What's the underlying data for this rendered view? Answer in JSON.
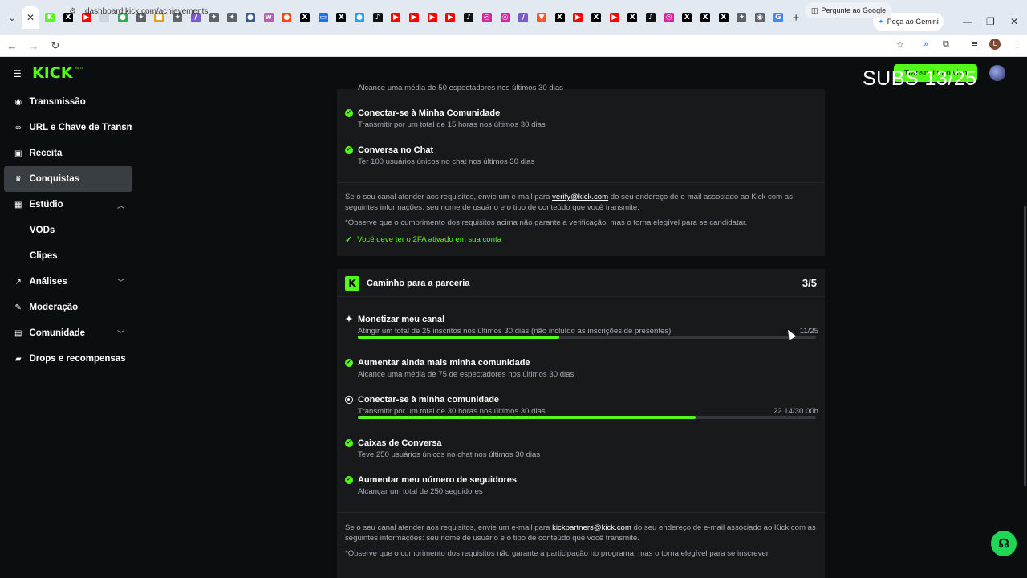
{
  "browser": {
    "url": "dashboard.kick.com/achievements",
    "gemini_label": "Peça ao Gemini",
    "google_pill": "Pergunte ao Google",
    "profile_initial": "L",
    "tabs": [
      {
        "icon": "kick-icon",
        "color": "#53fc18",
        "glyph": "K"
      },
      {
        "icon": "x-icon",
        "color": "#000000",
        "glyph": "X"
      },
      {
        "icon": "youtube-icon",
        "color": "#ff0000",
        "glyph": "▶"
      },
      {
        "icon": "blank-icon",
        "color": "#cfd6e0",
        "glyph": ""
      },
      {
        "icon": "globe-icon",
        "color": "#3aa757",
        "glyph": "●"
      },
      {
        "icon": "gear-icon",
        "color": "#5f6368",
        "glyph": "✦"
      },
      {
        "icon": "sheets-icon",
        "color": "#e2a01d",
        "glyph": "■"
      },
      {
        "icon": "gear-icon",
        "color": "#5f6368",
        "glyph": "✦"
      },
      {
        "icon": "feather-icon",
        "color": "#7a5cc8",
        "glyph": "/"
      },
      {
        "icon": "gear-icon",
        "color": "#5f6368",
        "glyph": "✦"
      },
      {
        "icon": "gear-icon",
        "color": "#5f6368",
        "glyph": "✦"
      },
      {
        "icon": "circle-icon",
        "color": "#3b5998",
        "glyph": "●"
      },
      {
        "icon": "feather-icon",
        "color": "#b85fae",
        "glyph": "w"
      },
      {
        "icon": "reddit-icon",
        "color": "#ff4500",
        "glyph": "●"
      },
      {
        "icon": "x-icon",
        "color": "#000000",
        "glyph": "X"
      },
      {
        "icon": "mail-icon",
        "color": "#1a73e8",
        "glyph": "▭"
      },
      {
        "icon": "x-icon",
        "color": "#000000",
        "glyph": "X"
      },
      {
        "icon": "circle-icon",
        "color": "#1da1f2",
        "glyph": "●"
      },
      {
        "icon": "tiktok-icon",
        "color": "#111111",
        "glyph": "♪"
      },
      {
        "icon": "youtube-icon",
        "color": "#ff0000",
        "glyph": "▶"
      },
      {
        "icon": "youtube-icon",
        "color": "#ff0000",
        "glyph": "▶"
      },
      {
        "icon": "youtube-icon",
        "color": "#ff0000",
        "glyph": "▶"
      },
      {
        "icon": "youtube-icon",
        "color": "#ff0000",
        "glyph": "▶"
      },
      {
        "icon": "tiktok-icon",
        "color": "#111111",
        "glyph": "♪"
      },
      {
        "icon": "instagram-icon",
        "color": "#d6249f",
        "glyph": "◎"
      },
      {
        "icon": "instagram-icon",
        "color": "#d6249f",
        "glyph": "◎"
      },
      {
        "icon": "feather-icon",
        "color": "#7a5cc8",
        "glyph": "/"
      },
      {
        "icon": "brave-icon",
        "color": "#fb542b",
        "glyph": "▼"
      },
      {
        "icon": "x-icon",
        "color": "#000000",
        "glyph": "X"
      },
      {
        "icon": "youtube-icon",
        "color": "#ff0000",
        "glyph": "▶"
      },
      {
        "icon": "x-icon",
        "color": "#000000",
        "glyph": "X"
      },
      {
        "icon": "youtube-icon",
        "color": "#ff0000",
        "glyph": "▶"
      },
      {
        "icon": "x-icon",
        "color": "#000000",
        "glyph": "X"
      },
      {
        "icon": "tiktok-icon",
        "color": "#111111",
        "glyph": "♪"
      },
      {
        "icon": "instagram-icon",
        "color": "#d6249f",
        "glyph": "◎"
      },
      {
        "icon": "x-icon",
        "color": "#000000",
        "glyph": "X"
      },
      {
        "icon": "x-icon",
        "color": "#000000",
        "glyph": "X"
      },
      {
        "icon": "x-icon",
        "color": "#000000",
        "glyph": "X"
      },
      {
        "icon": "gear-icon",
        "color": "#5f6368",
        "glyph": "✦"
      },
      {
        "icon": "chrome-icon",
        "color": "#5f6368",
        "glyph": "◉"
      },
      {
        "icon": "google-icon",
        "color": "#4285f4",
        "glyph": "G"
      }
    ]
  },
  "header": {
    "logo": "KICK",
    "beta": "BETA",
    "go_live": "Transmitir ao vivo",
    "overlay": "SUBS  13/25"
  },
  "sidebar": {
    "items": [
      {
        "label": "Transmissão",
        "icon": "broadcast-icon",
        "glyph": "◉"
      },
      {
        "label": "URL e Chave de Transmissão",
        "icon": "link-icon",
        "glyph": "∞"
      },
      {
        "label": "Receita",
        "icon": "revenue-icon",
        "glyph": "▣"
      },
      {
        "label": "Conquistas",
        "icon": "trophy-icon",
        "glyph": "♛"
      },
      {
        "label": "Estúdio",
        "icon": "studio-icon",
        "glyph": "▦"
      },
      {
        "label": "Análises",
        "icon": "analytics-icon",
        "glyph": "↗"
      },
      {
        "label": "Moderação",
        "icon": "wrench-icon",
        "glyph": "✎"
      },
      {
        "label": "Comunidade",
        "icon": "community-icon",
        "glyph": "▤"
      },
      {
        "label": "Drops e recompensas",
        "icon": "drops-icon",
        "glyph": "▰"
      }
    ],
    "sub_items": [
      "VODs",
      "Clipes"
    ]
  },
  "verification": {
    "cut_desc": "Alcance uma média de 50 espectadores nos últimos 30 dias",
    "requirements": [
      {
        "title": "Conectar-se à Minha Comunidade",
        "desc": "Transmitir por um total de 15 horas nos últimos 30 dias"
      },
      {
        "title": "Conversa no Chat",
        "desc": "Ter 100 usuários únicos no chat nos últimos 30 dias"
      }
    ],
    "note_before": "Se o seu canal atender aos requisitos, envie um e-mail para ",
    "email": "verify@kick.com",
    "note_after": " do seu endereço de e-mail associado ao Kick com as seguintes informações: seu nome de usuário e o tipo de conteúdo que você transmite.",
    "disclaimer": "*Observe que o cumprimento dos requisitos acima não garante a verificação, mas o torna elegível para se candidatar.",
    "twofa": "Você deve ter o 2FA ativado em sua conta"
  },
  "partner": {
    "title": "Caminho para a parceria",
    "count": "3/5",
    "requirements": [
      {
        "title": "Monetizar meu canal",
        "desc": "Atingir um total de 25 inscritos nos últimos 30 dias (não incluído as inscrições de presentes)",
        "progress_text": "11/25",
        "progress": 0.44,
        "status": "in-progress"
      },
      {
        "title": "Aumentar ainda mais minha comunidade",
        "desc": "Alcance uma média de 75 de espectadores nos últimos 30 dias",
        "status": "done"
      },
      {
        "title": "Conectar-se à minha comunidade",
        "desc": "Transmitir por um total de 30 horas nos últimos 30 dias",
        "progress_text": "22.14/30.00h",
        "progress": 0.738,
        "status": "in-progress"
      },
      {
        "title": "Caixas de Conversa",
        "desc": "Teve 250 usuários únicos no chat nos últimos 30 dias",
        "status": "done"
      },
      {
        "title": "Aumentar meu número de seguidores",
        "desc": "Alcançar um total de 250 seguidores",
        "status": "done"
      }
    ],
    "note_before": "Se o seu canal atender aos requisitos, envie um e-mail para ",
    "email": "kickpartners@kick.com",
    "note_after": " do seu endereço de e-mail associado ao Kick com as seguintes informações: seu nome de usuário e o tipo de conteúdo que você transmite.",
    "disclaimer": "*Observe que o cumprimento dos requisitos não garante a participação no programa, mas o torna elegível para se inscrever."
  },
  "colors": {
    "accent": "#53fc18",
    "card": "#17191b",
    "bg": "#0b0e0f"
  }
}
